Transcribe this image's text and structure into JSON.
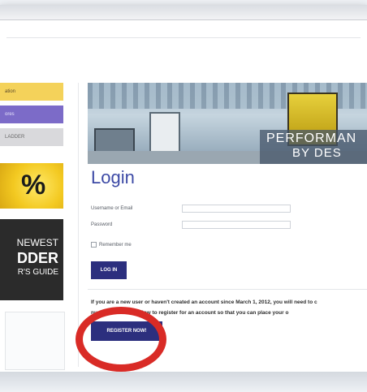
{
  "nav": {
    "items": [
      {
        "label": "ation"
      },
      {
        "label": "ores"
      },
      {
        "label": "LADDER"
      }
    ]
  },
  "promos": {
    "percent": "%",
    "guide_line1": "NEWEST",
    "guide_line2": "DDER",
    "guide_line3": "R'S GUIDE"
  },
  "hero": {
    "line1": "PERFORMAN",
    "line2": "BY DES"
  },
  "login": {
    "title": "Login",
    "username_label": "Username or Email",
    "password_label": "Password",
    "remember_label": "Remember me",
    "login_button": "LOG IN"
  },
  "notice": {
    "line1": "If you are a new user or haven't created an account since March 1, 2012, you will need to c",
    "line2": "nu              button below to register for an account so that you can place your o",
    "line3": "line."
  },
  "register": {
    "button": "REGISTER NOW!"
  },
  "colors": {
    "accent": "#3d4aa6",
    "button": "#2c2f7e",
    "highlight": "#d92b26"
  }
}
